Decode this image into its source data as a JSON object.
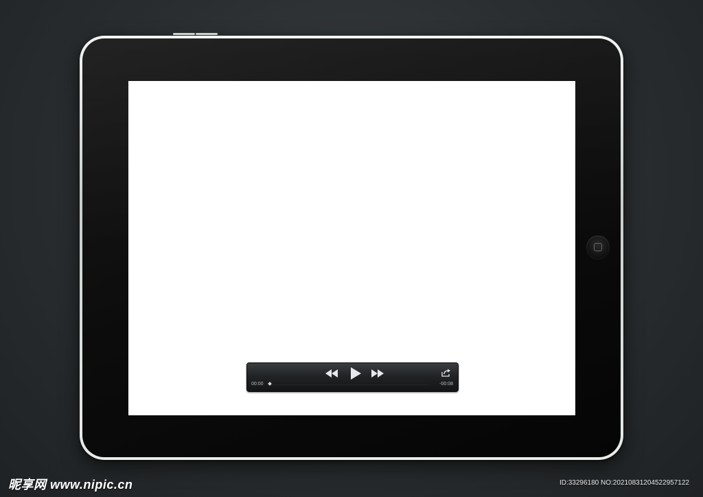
{
  "player": {
    "elapsed_time": "00:00",
    "remaining_time": "-00:08",
    "progress": 0,
    "icons": {
      "rewind": "rewind-icon",
      "play": "play-icon",
      "forward": "fast-forward-icon",
      "share": "share-icon"
    }
  },
  "device": {
    "home_button_icon": "home-button-icon"
  },
  "watermark": {
    "logo": "昵享网 www.nipic.cn",
    "id_text": "ID:33296180 NO:20210831204522957122"
  }
}
